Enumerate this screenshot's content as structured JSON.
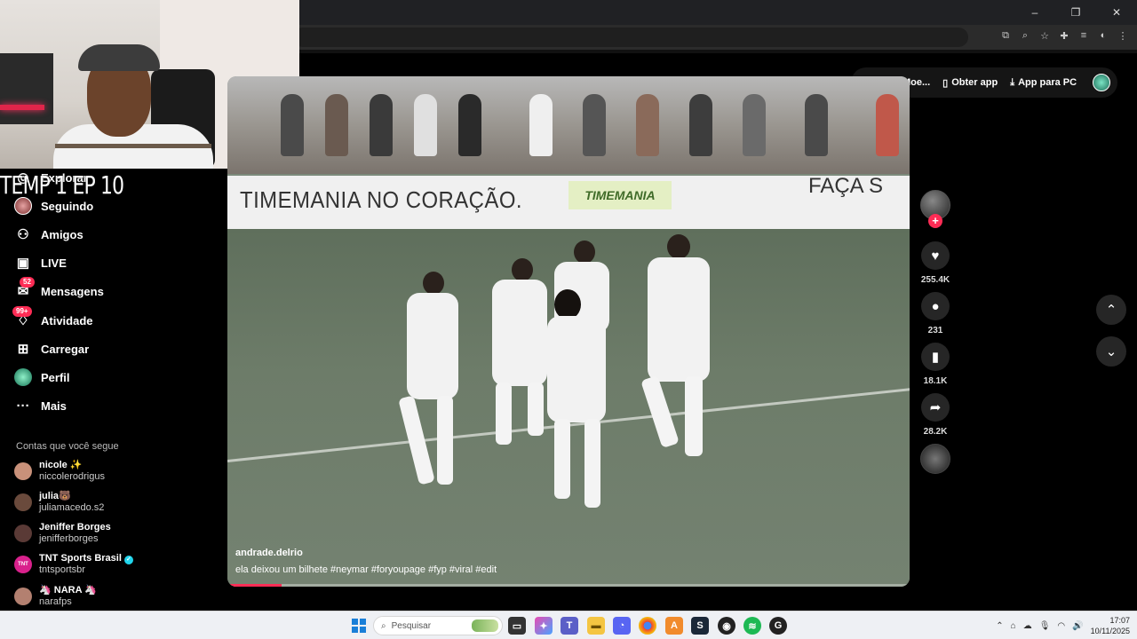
{
  "overlay_title": "TEMP 1 EP 10",
  "window_controls": {
    "minimize": "–",
    "restore": "❐",
    "close": "✕"
  },
  "top_actions": {
    "coins": "Obter Moe...",
    "get_app": "Obter app",
    "pc_app": "App para PC"
  },
  "sidebar": {
    "items": [
      {
        "label": "Explorar",
        "icon": "compass-icon"
      },
      {
        "label": "Seguindo",
        "icon": "following-avatar"
      },
      {
        "label": "Amigos",
        "icon": "friends-icon"
      },
      {
        "label": "LIVE",
        "icon": "live-icon"
      },
      {
        "label": "Mensagens",
        "icon": "messages-icon",
        "badge": "52"
      },
      {
        "label": "Atividade",
        "icon": "activity-icon",
        "badge": "99+"
      },
      {
        "label": "Carregar",
        "icon": "upload-icon"
      },
      {
        "label": "Perfil",
        "icon": "profile-avatar"
      },
      {
        "label": "Mais",
        "icon": "more-icon"
      }
    ],
    "following_title": "Contas que você segue",
    "following": [
      {
        "name": "nicole ✨",
        "handle": "niccolerodrigus",
        "color": "#c9917a"
      },
      {
        "name": "julia🐻",
        "handle": "juliamacedo.s2",
        "color": "#6a4a3c"
      },
      {
        "name": "Jeniffer Borges",
        "handle": "jenifferborges",
        "color": "#5a3a36"
      },
      {
        "name": "TNT Sports Brasil",
        "handle": "tntsportsbr",
        "color": "#d9218c",
        "verified": true
      },
      {
        "name": "🦄 NARA 🦄",
        "handle": "narafps",
        "color": "#b38070"
      }
    ]
  },
  "video": {
    "banner_text": "TIMEMANIA NO CORAÇÃO.",
    "sponsor": "TIMEMANIA",
    "banner_right": "FAÇA S",
    "author": "andrade.delrio",
    "description": "ela deixou um bilhete  #neymar  #foryoupage  #fyp  #viral  #edit",
    "progress": 0.08
  },
  "actions": {
    "likes": "255.4K",
    "comments": "231",
    "saves": "18.1K",
    "shares": "28.2K"
  },
  "taskbar": {
    "search_placeholder": "Pesquisar",
    "time": "17:07",
    "date": "10/11/2025"
  }
}
